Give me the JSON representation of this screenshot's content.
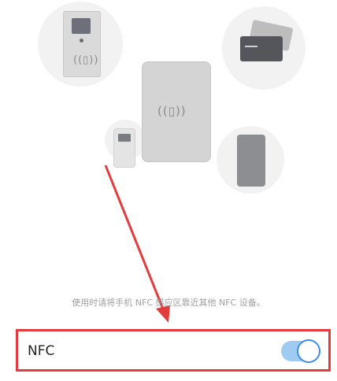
{
  "illustration": {
    "hint_text": "使用时请将手机 NFC 感应区靠近其他 NFC 设备。"
  },
  "settings": {
    "nfc_label": "NFC",
    "nfc_enabled": true
  },
  "annotation": {
    "highlight_color": "#e23c3c"
  },
  "accent_color": "#3b8ee8"
}
